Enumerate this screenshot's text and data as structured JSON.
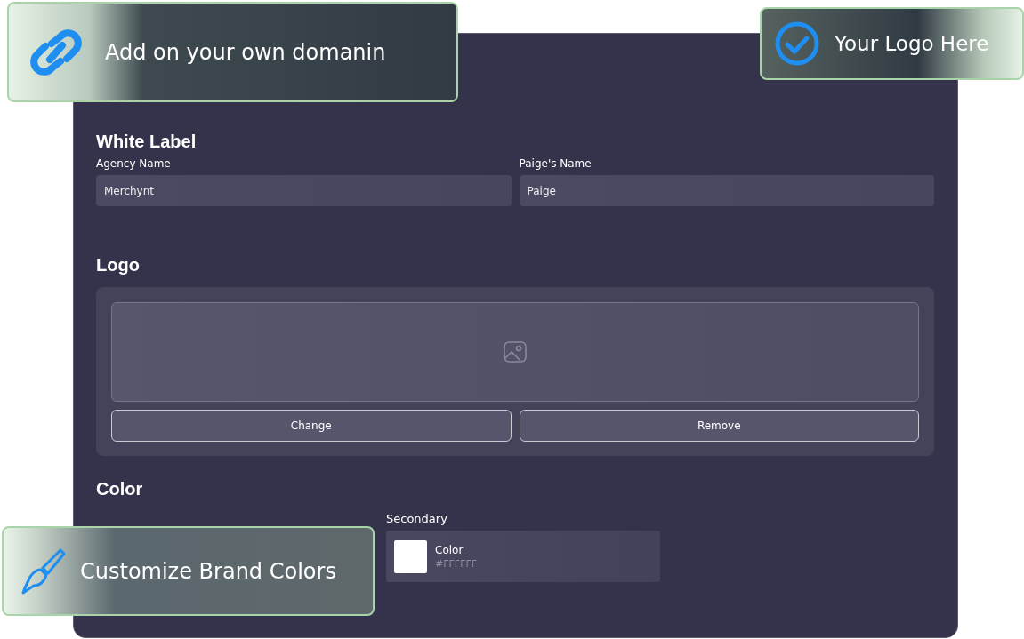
{
  "callouts": [
    {
      "kind": "link",
      "text": "Add on your own domanin"
    },
    {
      "kind": "check",
      "text": "Your Logo Here"
    },
    {
      "kind": "brush",
      "text": "Customize Brand Colors"
    }
  ],
  "white_label": {
    "title": "White Label",
    "fields": [
      {
        "label": "Agency Name",
        "value": "Merchynt"
      },
      {
        "label": "Paige's Name",
        "value": "Paige"
      }
    ]
  },
  "logo": {
    "title": "Logo",
    "buttons": [
      "Change",
      "Remove"
    ]
  },
  "color": {
    "title": "Color",
    "items": [
      {
        "label": "Secondary",
        "name": "Color",
        "hex": "#FFFFFF",
        "color": "#ffffff"
      }
    ]
  }
}
